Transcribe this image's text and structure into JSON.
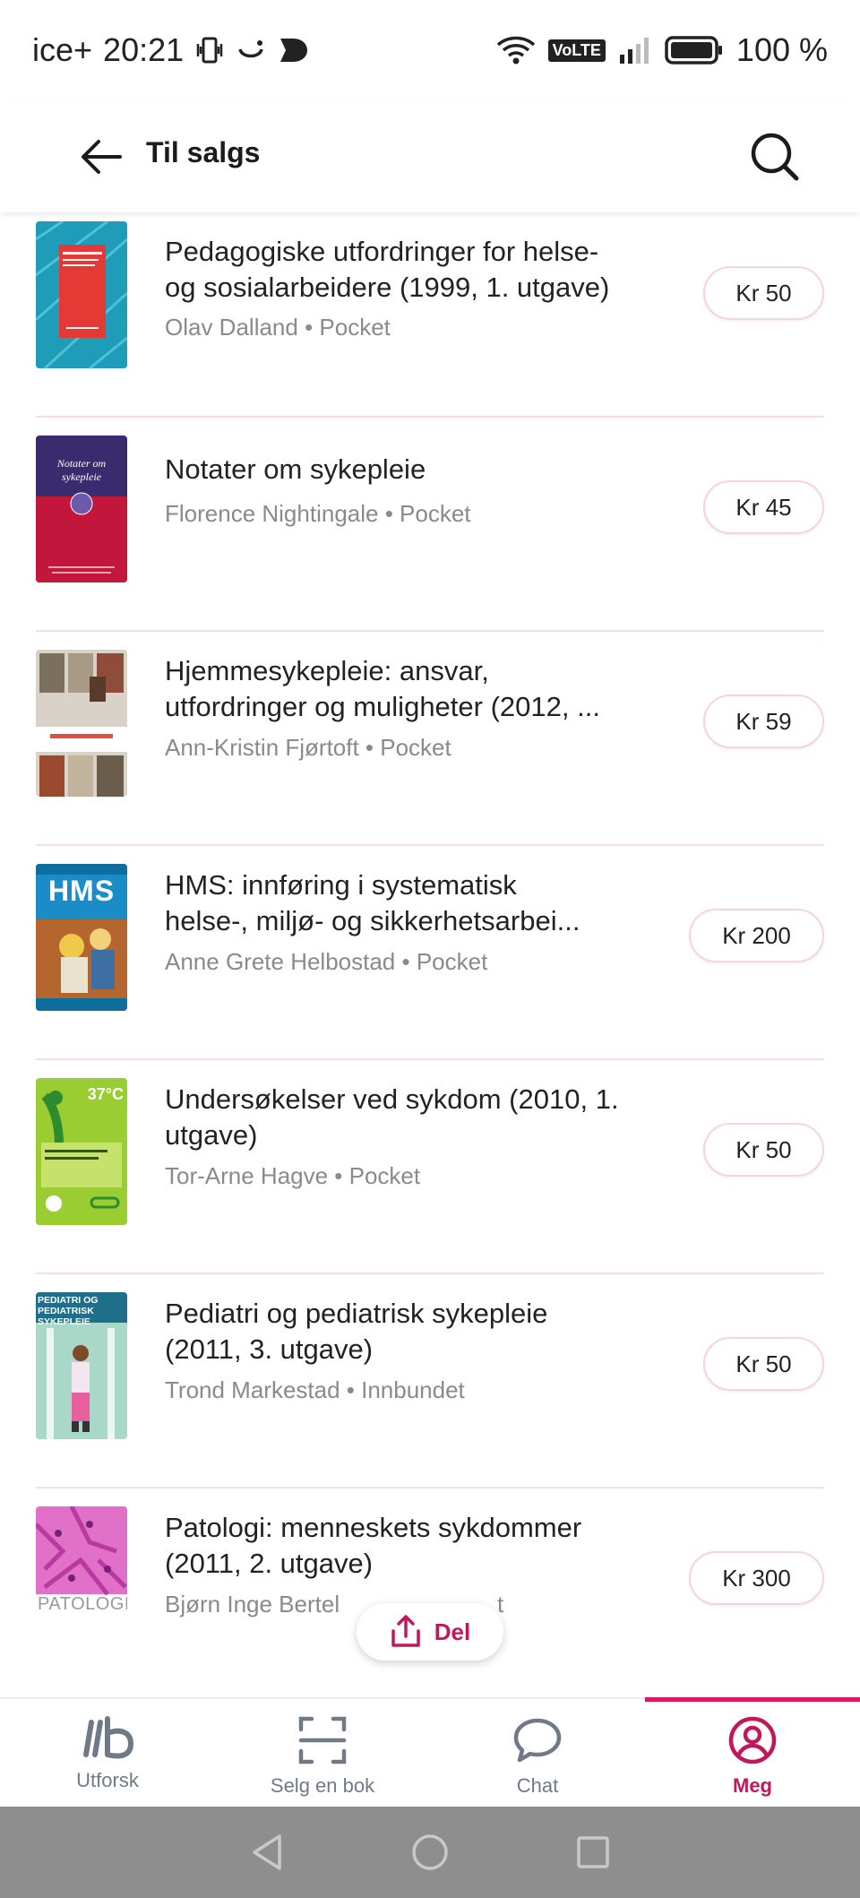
{
  "status_bar": {
    "carrier": "ice+",
    "time": "20:21",
    "volte": "VoLTE",
    "battery": "100 %"
  },
  "header": {
    "title": "Til salgs"
  },
  "books": [
    {
      "title": "Pedagogiske utfordringer for helse- og sosialarbeidere (1999, 1. utgave)",
      "title_lines": [
        "Pedagogiske utfordringer for helse-",
        "og sosialarbeidere (1999, 1. utgave)"
      ],
      "meta": "Olav Dalland • Pocket",
      "price": "Kr 50"
    },
    {
      "title": "Notater om sykepleie",
      "title_lines": [
        "Notater om sykepleie"
      ],
      "meta": "Florence Nightingale • Pocket",
      "price": "Kr 45",
      "cover_text": "Notater om sykepleie"
    },
    {
      "title": "Hjemmesykepleie: ansvar, utfordringer og muligheter (2012, ...",
      "title_lines": [
        "Hjemmesykepleie: ansvar,",
        "utfordringer og muligheter (2012, ..."
      ],
      "meta": "Ann-Kristin Fjørtoft • Pocket",
      "price": "Kr 59"
    },
    {
      "title": "HMS: innføring i systematisk helse-, miljø- og sikkerhetsarbei...",
      "title_lines": [
        "HMS: innføring i systematisk",
        "helse-, miljø- og sikkerhetsarbei..."
      ],
      "meta": "Anne Grete Helbostad • Pocket",
      "price": "Kr 200",
      "cover_text": "HMS"
    },
    {
      "title": "Undersøkelser ved sykdom (2010, 1. utgave)",
      "title_lines": [
        "Undersøkelser ved sykdom (2010, 1.",
        "utgave)"
      ],
      "meta": "Tor-Arne Hagve • Pocket",
      "price": "Kr 50",
      "cover_text": "37°C"
    },
    {
      "title": "Pediatri og pediatrisk sykepleie (2011, 3. utgave)",
      "title_lines": [
        "Pediatri og pediatrisk sykepleie",
        "(2011, 3. utgave)"
      ],
      "meta": "Trond Markestad • Innbundet",
      "price": "Kr 50",
      "cover_text": "PEDIATRI OG PEDIATRISK SYKEPLEIE"
    },
    {
      "title": "Patologi: menneskets sykdommer (2011, 2. utgave)",
      "title_lines": [
        "Patologi: menneskets sykdommer",
        "(2011, 2. utgave)"
      ],
      "meta": "Bjørn Inge Bertel",
      "meta_tail": "t",
      "price": "Kr 300",
      "cover_text": "PATOLOGI"
    }
  ],
  "share": {
    "label": "Del"
  },
  "bottom_nav": [
    {
      "label": "Utforsk",
      "icon": "explore-icon",
      "active": false
    },
    {
      "label": "Selg en bok",
      "icon": "scan-icon",
      "active": false
    },
    {
      "label": "Chat",
      "icon": "chat-icon",
      "active": false
    },
    {
      "label": "Meg",
      "icon": "profile-icon",
      "active": true
    }
  ],
  "colors": {
    "accent": "#c2185b",
    "divider": "#f6dde4",
    "muted": "#8a8a8a",
    "nav_inactive": "#6f7a86",
    "system_nav": "#8e8e8e"
  }
}
